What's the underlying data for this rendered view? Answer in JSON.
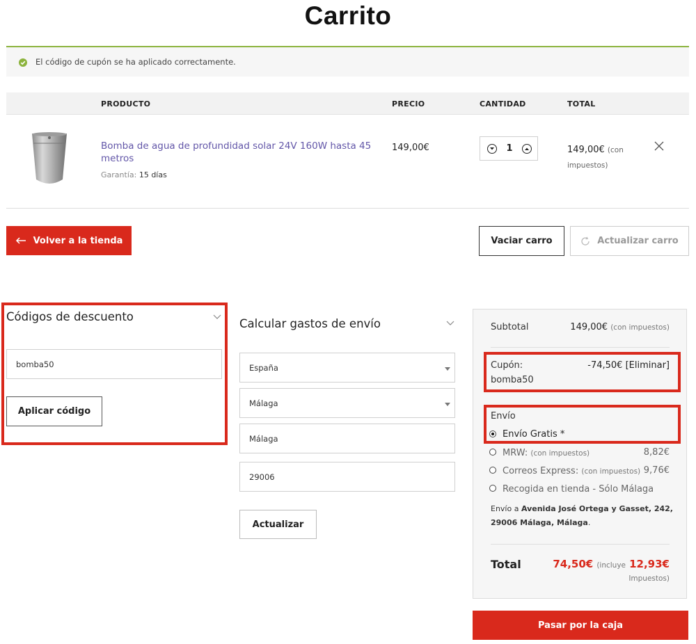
{
  "page": {
    "title": "Carrito"
  },
  "notice": {
    "message": "El código de cupón se ha aplicado correctamente."
  },
  "table": {
    "headers": [
      "PRODUCTO",
      "PRECIO",
      "CANTIDAD",
      "TOTAL"
    ],
    "item": {
      "name": "Bomba de agua de profundidad solar 24V 160W hasta 45 metros",
      "warranty_label": "Garantía:",
      "warranty_value": "15 días",
      "price": "149,00€",
      "quantity": "1",
      "total": "149,00€",
      "total_note": "(con impuestos)"
    }
  },
  "actions": {
    "back": "Volver a la tienda",
    "empty": "Vaciar carro",
    "update": "Actualizar carro"
  },
  "coupon": {
    "title": "Códigos de descuento",
    "value": "bomba50",
    "apply": "Aplicar código"
  },
  "shipping_calc": {
    "title": "Calcular gastos de envío",
    "country": "España",
    "province": "Málaga",
    "city": "Málaga",
    "postcode": "29006",
    "update": "Actualizar"
  },
  "summary": {
    "subtotal_label": "Subtotal",
    "subtotal_value": "149,00€",
    "subtotal_note": "(con impuestos)",
    "coupon_label": "Cupón:",
    "coupon_code": "bomba50",
    "coupon_value": "-74,50€",
    "coupon_remove": "[Eliminar]",
    "shipping_label": "Envío",
    "shipping_options": [
      {
        "label": "Envío Gratis *",
        "note": "",
        "price": "",
        "selected": true
      },
      {
        "label": "MRW:",
        "note": "(con impuestos)",
        "price": "8,82€",
        "selected": false
      },
      {
        "label": "Correos Express:",
        "note": "(con impuestos)",
        "price": "9,76€",
        "selected": false
      },
      {
        "label": "Recogida en tienda - Sólo Málaga",
        "note": "",
        "price": "",
        "selected": false
      }
    ],
    "ship_to_prefix": "Envío a",
    "ship_to_address": "Avenida José Ortega y Gasset, 242, 29006 Málaga, Málaga",
    "ship_to_suffix": ".",
    "total_label": "Total",
    "total_value": "74,50€",
    "total_includes": "(incluye",
    "tax_value": "12,93€",
    "tax_label": "Impuestos)"
  },
  "checkout": {
    "label": "Pasar por la caja"
  },
  "colors": {
    "accent": "#d9291c",
    "success": "#8cb33d",
    "link": "#6256a8"
  }
}
